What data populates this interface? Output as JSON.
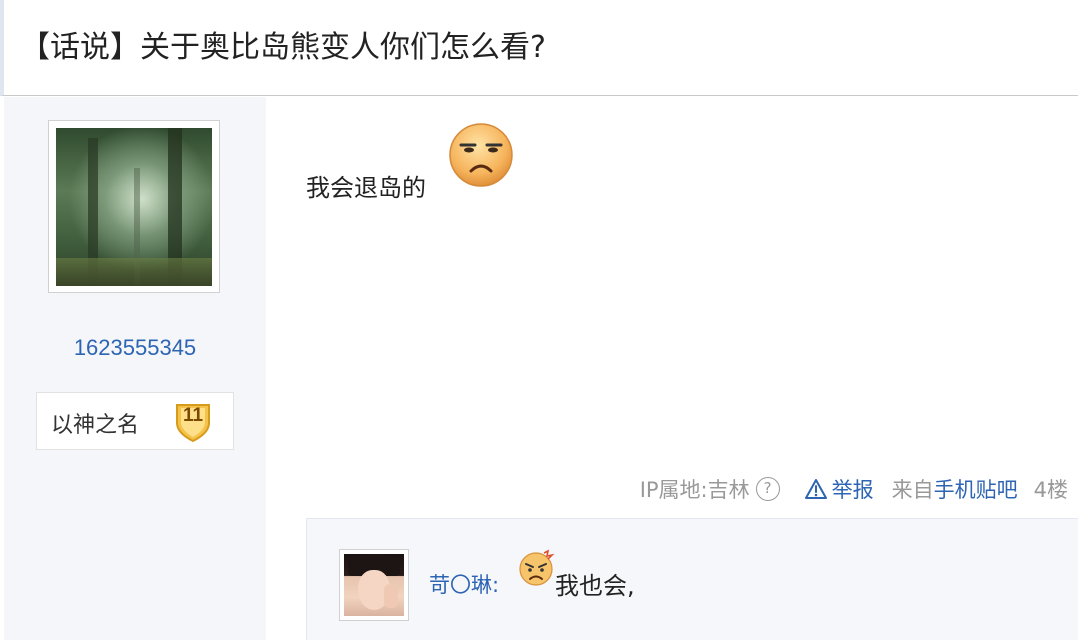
{
  "thread": {
    "title": "【话说】关于奥比岛熊变人你们怎么看?"
  },
  "author": {
    "username": "1623555345",
    "badge_name": "以神之名",
    "badge_level": "11"
  },
  "post": {
    "content": "我会退岛的",
    "emoji": "frown-face-emoji"
  },
  "meta": {
    "ip": "IP属地:吉林",
    "help_glyph": "?",
    "report": "举报",
    "from_prefix": "来自",
    "from_app": "手机贴吧",
    "floor": "4楼"
  },
  "reply": {
    "username": "苛〇琳",
    "separator": ":",
    "emoji": "angry-face-emoji",
    "text": "我也会,"
  },
  "colors": {
    "link": "#2d64b3",
    "meta": "#999999",
    "sidebar_bg": "#f4f6fa",
    "badge_gold": "#f5c24a"
  }
}
